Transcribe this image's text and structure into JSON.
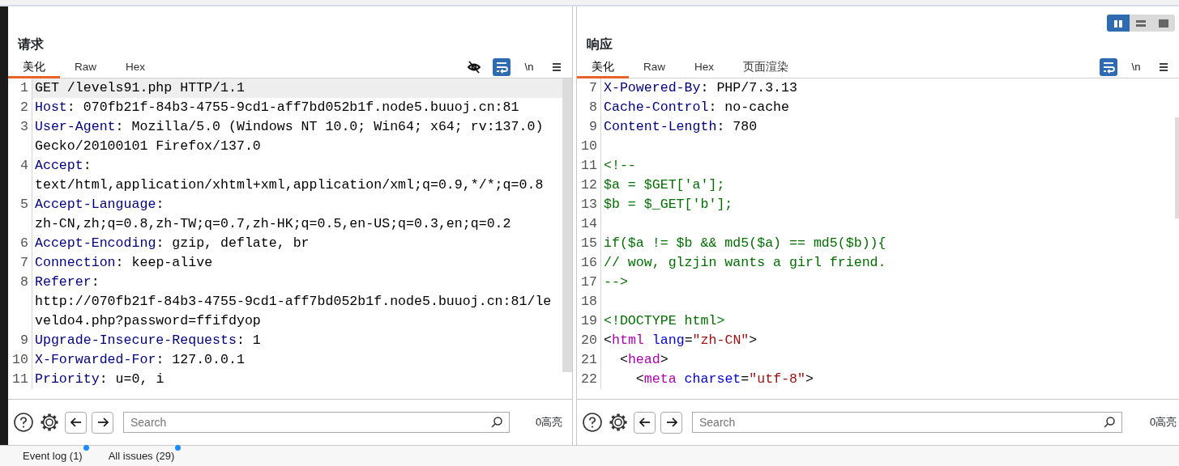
{
  "request": {
    "title": "请求",
    "tabs": [
      {
        "label": "美化",
        "selected": true
      },
      {
        "label": "Raw",
        "selected": false
      },
      {
        "label": "Hex",
        "selected": false
      }
    ],
    "tools": [
      {
        "kind": "hide",
        "active": false
      },
      {
        "kind": "wrap",
        "active": true
      },
      {
        "kind": "newline",
        "label": "\\n",
        "active": false
      },
      {
        "kind": "menu",
        "active": false
      }
    ],
    "lines": [
      {
        "number": "1",
        "highlighted": true,
        "rows": [
          [
            {
              "kind": "plain",
              "text": "GET /levels91.php HTTP/1.1"
            }
          ]
        ]
      },
      {
        "number": "2",
        "highlighted": false,
        "rows": [
          [
            {
              "kind": "name",
              "text": "Host"
            },
            {
              "kind": "plain",
              "text": ": 070fb21f-84b3-4755-9cd1-aff7bd052b1f.node5.buuoj.cn:81"
            }
          ]
        ]
      },
      {
        "number": "3",
        "highlighted": false,
        "rows": [
          [
            {
              "kind": "name",
              "text": "User-Agent"
            },
            {
              "kind": "plain",
              "text": ": Mozilla/5.0 (Windows NT 10.0; Win64; x64; rv:137.0)"
            }
          ],
          [
            {
              "kind": "plain",
              "text": "Gecko/20100101 Firefox/137.0"
            }
          ]
        ]
      },
      {
        "number": "4",
        "highlighted": false,
        "rows": [
          [
            {
              "kind": "name",
              "text": "Accept"
            },
            {
              "kind": "plain",
              "text": ":"
            }
          ],
          [
            {
              "kind": "plain",
              "text": "text/html,application/xhtml+xml,application/xml;q=0.9,*/*;q=0.8"
            }
          ]
        ]
      },
      {
        "number": "5",
        "highlighted": false,
        "rows": [
          [
            {
              "kind": "name",
              "text": "Accept-Language"
            },
            {
              "kind": "plain",
              "text": ":"
            }
          ],
          [
            {
              "kind": "plain",
              "text": "zh-CN,zh;q=0.8,zh-TW;q=0.7,zh-HK;q=0.5,en-US;q=0.3,en;q=0.2"
            }
          ]
        ]
      },
      {
        "number": "6",
        "highlighted": false,
        "rows": [
          [
            {
              "kind": "name",
              "text": "Accept-Encoding"
            },
            {
              "kind": "plain",
              "text": ": gzip, deflate, br"
            }
          ]
        ]
      },
      {
        "number": "7",
        "highlighted": false,
        "rows": [
          [
            {
              "kind": "name",
              "text": "Connection"
            },
            {
              "kind": "plain",
              "text": ": keep-alive"
            }
          ]
        ]
      },
      {
        "number": "8",
        "highlighted": false,
        "rows": [
          [
            {
              "kind": "name",
              "text": "Referer"
            },
            {
              "kind": "plain",
              "text": ":"
            }
          ],
          [
            {
              "kind": "plain",
              "text": "http://070fb21f-84b3-4755-9cd1-aff7bd052b1f.node5.buuoj.cn:81/le"
            }
          ],
          [
            {
              "kind": "plain",
              "text": "veldo4.php?password=ffifdyop"
            }
          ]
        ]
      },
      {
        "number": "9",
        "highlighted": false,
        "rows": [
          [
            {
              "kind": "name",
              "text": "Upgrade-Insecure-Requests"
            },
            {
              "kind": "plain",
              "text": ": 1"
            }
          ]
        ]
      },
      {
        "number": "10",
        "highlighted": false,
        "rows": [
          [
            {
              "kind": "name",
              "text": "X-Forwarded-For"
            },
            {
              "kind": "plain",
              "text": ": 127.0.0.1"
            }
          ]
        ]
      },
      {
        "number": "11",
        "highlighted": false,
        "rows": [
          [
            {
              "kind": "name",
              "text": "Priority"
            },
            {
              "kind": "plain",
              "text": ": u=0, i"
            }
          ]
        ]
      }
    ],
    "search": {
      "placeholder": "Search"
    },
    "highlight_count": "0高亮"
  },
  "response": {
    "title": "响应",
    "layout_buttons": [
      {
        "kind": "columns",
        "selected": true
      },
      {
        "kind": "rows",
        "selected": false
      },
      {
        "kind": "single",
        "selected": false
      }
    ],
    "tabs": [
      {
        "label": "美化",
        "selected": true
      },
      {
        "label": "Raw",
        "selected": false
      },
      {
        "label": "Hex",
        "selected": false
      },
      {
        "label": "页面渲染",
        "selected": false
      }
    ],
    "tools": [
      {
        "kind": "wrap",
        "active": true
      },
      {
        "kind": "newline",
        "label": "\\n",
        "active": false
      },
      {
        "kind": "menu",
        "active": false
      }
    ],
    "lines": [
      {
        "number": "7",
        "highlighted": false,
        "rows": [
          [
            {
              "kind": "name",
              "text": "X-Powered-By"
            },
            {
              "kind": "plain",
              "text": ": PHP/7.3.13"
            }
          ]
        ]
      },
      {
        "number": "8",
        "highlighted": false,
        "rows": [
          [
            {
              "kind": "name",
              "text": "Cache-Control"
            },
            {
              "kind": "plain",
              "text": ": no-cache"
            }
          ]
        ]
      },
      {
        "number": "9",
        "highlighted": false,
        "rows": [
          [
            {
              "kind": "name",
              "text": "Content-Length"
            },
            {
              "kind": "plain",
              "text": ": 780"
            }
          ]
        ]
      },
      {
        "number": "10",
        "highlighted": false,
        "rows": [
          []
        ]
      },
      {
        "number": "11",
        "highlighted": false,
        "rows": [
          [
            {
              "kind": "comment",
              "text": "<!--"
            }
          ]
        ]
      },
      {
        "number": "12",
        "highlighted": false,
        "rows": [
          [
            {
              "kind": "comment",
              "text": "$a = $GET['a'];"
            }
          ]
        ]
      },
      {
        "number": "13",
        "highlighted": false,
        "rows": [
          [
            {
              "kind": "comment",
              "text": "$b = $_GET['b'];"
            }
          ]
        ]
      },
      {
        "number": "14",
        "highlighted": false,
        "rows": [
          []
        ]
      },
      {
        "number": "15",
        "highlighted": false,
        "rows": [
          [
            {
              "kind": "comment",
              "text": "if($a != $b && md5($a) == md5($b)){"
            }
          ]
        ]
      },
      {
        "number": "16",
        "highlighted": false,
        "rows": [
          [
            {
              "kind": "comment",
              "text": "// wow, glzjin wants a girl friend."
            }
          ]
        ]
      },
      {
        "number": "17",
        "highlighted": false,
        "rows": [
          [
            {
              "kind": "comment",
              "text": "-->"
            }
          ]
        ]
      },
      {
        "number": "18",
        "highlighted": false,
        "rows": [
          []
        ]
      },
      {
        "number": "19",
        "highlighted": false,
        "rows": [
          [
            {
              "kind": "comment",
              "text": "<!DOCTYPE html>"
            }
          ]
        ]
      },
      {
        "number": "20",
        "highlighted": false,
        "rows": [
          [
            {
              "kind": "plain",
              "text": "<"
            },
            {
              "kind": "tag",
              "text": "html"
            },
            {
              "kind": "plain",
              "text": " "
            },
            {
              "kind": "attr",
              "text": "lang"
            },
            {
              "kind": "plain",
              "text": "="
            },
            {
              "kind": "value",
              "text": "\"zh-CN\""
            },
            {
              "kind": "plain",
              "text": ">"
            }
          ]
        ]
      },
      {
        "number": "21",
        "highlighted": false,
        "rows": [
          [
            {
              "kind": "plain",
              "text": "  <"
            },
            {
              "kind": "tag",
              "text": "head"
            },
            {
              "kind": "plain",
              "text": ">"
            }
          ]
        ]
      },
      {
        "number": "22",
        "highlighted": false,
        "rows": [
          [
            {
              "kind": "plain",
              "text": "    <"
            },
            {
              "kind": "tag",
              "text": "meta"
            },
            {
              "kind": "plain",
              "text": " "
            },
            {
              "kind": "attr",
              "text": "charset"
            },
            {
              "kind": "plain",
              "text": "="
            },
            {
              "kind": "value",
              "text": "\"utf-8\""
            },
            {
              "kind": "plain",
              "text": ">"
            }
          ]
        ]
      }
    ],
    "search": {
      "placeholder": "Search"
    },
    "highlight_count": "0高亮"
  },
  "status_bar": [
    {
      "label": "Event log (1)",
      "notified": true
    },
    {
      "label": "All issues (29)",
      "notified": true
    }
  ]
}
